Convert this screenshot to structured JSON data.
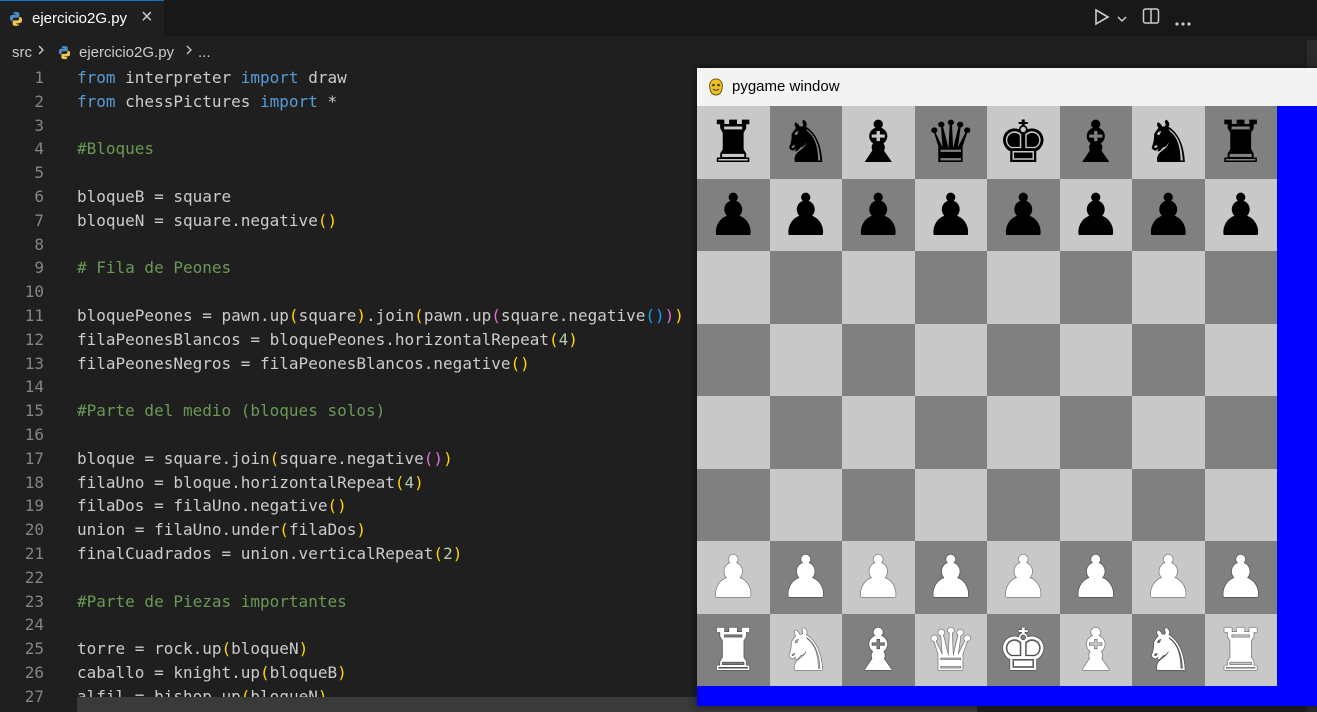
{
  "tab": {
    "filename": "ejercicio2G.py"
  },
  "breadcrumb": {
    "folder": "src",
    "file": "ejercicio2G.py",
    "more": "..."
  },
  "code_lines": [
    {
      "n": "1",
      "html": "<span class='kw'>from</span> interpreter <span class='kw'>import</span> draw"
    },
    {
      "n": "2",
      "html": "<span class='kw'>from</span> chessPictures <span class='kw'>import</span> *"
    },
    {
      "n": "3",
      "html": ""
    },
    {
      "n": "4",
      "html": "<span class='cm'>#Bloques</span>"
    },
    {
      "n": "5",
      "html": ""
    },
    {
      "n": "6",
      "html": "bloqueB = square"
    },
    {
      "n": "7",
      "html": "bloqueN = square.negative<span class='p1'>()</span>"
    },
    {
      "n": "8",
      "html": ""
    },
    {
      "n": "9",
      "html": "<span class='cm'># Fila de Peones</span>"
    },
    {
      "n": "10",
      "html": ""
    },
    {
      "n": "11",
      "html": "bloquePeones = pawn.up<span class='p1'>(</span>square<span class='p1'>)</span>.join<span class='p1'>(</span>pawn.up<span class='p2'>(</span>square.negative<span class='p3'>()</span><span class='p2'>)</span><span class='p1'>)</span>"
    },
    {
      "n": "12",
      "html": "filaPeonesBlancos = bloquePeones.horizontalRepeat<span class='p1'>(</span><span class='num'>4</span><span class='p1'>)</span>"
    },
    {
      "n": "13",
      "html": "filaPeonesNegros = filaPeonesBlancos.negative<span class='p1'>()</span>"
    },
    {
      "n": "14",
      "html": ""
    },
    {
      "n": "15",
      "html": "<span class='cm'>#Parte del medio (bloques solos)</span>"
    },
    {
      "n": "16",
      "html": ""
    },
    {
      "n": "17",
      "html": "bloque = square.join<span class='p1'>(</span>square.negative<span class='p2'>()</span><span class='p1'>)</span>"
    },
    {
      "n": "18",
      "html": "filaUno = bloque.horizontalRepeat<span class='p1'>(</span><span class='num'>4</span><span class='p1'>)</span>"
    },
    {
      "n": "19",
      "html": "filaDos = filaUno.negative<span class='p1'>()</span>"
    },
    {
      "n": "20",
      "html": "union = filaUno.under<span class='p1'>(</span>filaDos<span class='p1'>)</span>"
    },
    {
      "n": "21",
      "html": "finalCuadrados = union.verticalRepeat<span class='p1'>(</span><span class='num'>2</span><span class='p1'>)</span>"
    },
    {
      "n": "22",
      "html": ""
    },
    {
      "n": "23",
      "html": "<span class='cm'>#Parte de Piezas importantes</span>"
    },
    {
      "n": "24",
      "html": ""
    },
    {
      "n": "25",
      "html": "torre = rock.up<span class='p1'>(</span>bloqueN<span class='p1'>)</span>"
    },
    {
      "n": "26",
      "html": "caballo = knight.up<span class='p1'>(</span>bloqueB<span class='p1'>)</span>"
    },
    {
      "n": "27",
      "html": "alfil = bishop.up<span class='p1'>(</span>bloqueN<span class='p1'>)</span>"
    }
  ],
  "pygame": {
    "title": "pygame window",
    "board": {
      "colors": {
        "light": "#c8c8c8",
        "dark": "#808080",
        "background": "#0000ff"
      },
      "ranks": [
        [
          "black-rook",
          "black-knight",
          "black-bishop",
          "black-queen",
          "black-king",
          "black-bishop",
          "black-knight",
          "black-rook"
        ],
        [
          "black-pawn",
          "black-pawn",
          "black-pawn",
          "black-pawn",
          "black-pawn",
          "black-pawn",
          "black-pawn",
          "black-pawn"
        ],
        [
          "",
          "",
          "",
          "",
          "",
          "",
          "",
          ""
        ],
        [
          "",
          "",
          "",
          "",
          "",
          "",
          "",
          ""
        ],
        [
          "",
          "",
          "",
          "",
          "",
          "",
          "",
          ""
        ],
        [
          "",
          "",
          "",
          "",
          "",
          "",
          "",
          ""
        ],
        [
          "white-pawn",
          "white-pawn",
          "white-pawn",
          "white-pawn",
          "white-pawn",
          "white-pawn",
          "white-pawn",
          "white-pawn"
        ],
        [
          "white-rook",
          "white-knight",
          "white-bishop",
          "white-queen",
          "white-king",
          "white-bishop",
          "white-knight",
          "white-rook"
        ]
      ]
    }
  }
}
